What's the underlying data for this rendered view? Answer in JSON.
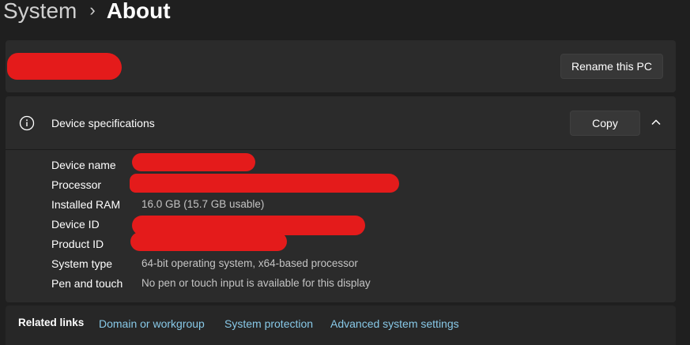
{
  "breadcrumb": {
    "parent": "System",
    "separator": "›",
    "current": "About"
  },
  "pc_name_card": {
    "rename_button": "Rename this PC"
  },
  "device_specs": {
    "title": "Device specifications",
    "copy_button": "Copy",
    "rows": [
      {
        "label": "Device name",
        "value": ""
      },
      {
        "label": "Processor",
        "value": ""
      },
      {
        "label": "Installed RAM",
        "value": "16.0 GB (15.7 GB usable)"
      },
      {
        "label": "Device ID",
        "value": ""
      },
      {
        "label": "Product ID",
        "value": ""
      },
      {
        "label": "System type",
        "value": "64-bit operating system, x64-based processor"
      },
      {
        "label": "Pen and touch",
        "value": "No pen or touch input is available for this display"
      }
    ]
  },
  "related_links": {
    "title": "Related links",
    "links": [
      "Domain or workgroup",
      "System protection",
      "Advanced system settings"
    ]
  },
  "colors": {
    "background": "#1f1f1f",
    "card": "#2b2b2b",
    "link": "#88c9e8",
    "redaction": "#e41b1b"
  }
}
